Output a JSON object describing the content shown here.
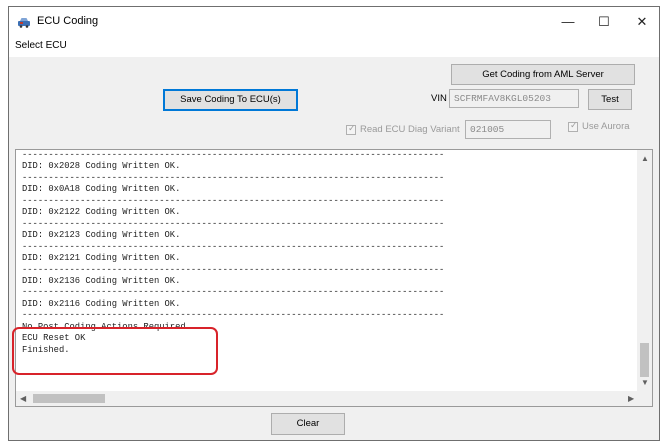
{
  "window": {
    "title": "ECU Coding",
    "controls": {
      "minimize": "—",
      "maximize": "☐",
      "close": "✕"
    }
  },
  "menu": {
    "items": [
      {
        "label": "Select ECU"
      }
    ]
  },
  "toolbar": {
    "get_coding_label": "Get Coding from AML Server",
    "save_coding_label": "Save Coding To ECU(s)",
    "test_label": "Test",
    "clear_label": "Clear"
  },
  "vin": {
    "label": "VIN",
    "value": "SCFRMFAV8KGL05203"
  },
  "diag": {
    "read_variant_label": "Read ECU Diag Variant",
    "read_variant_checked": true,
    "variant_value": "021005",
    "use_aurora_label": "Use Aurora",
    "use_aurora_checked": true
  },
  "log": {
    "separator": "--------------------------------------------------------------------------------",
    "lines": [
      "--------------------------------------------------------------------------------",
      "DID: 0x2028 Coding Written OK.",
      "--------------------------------------------------------------------------------",
      "DID: 0x0A18 Coding Written OK.",
      "--------------------------------------------------------------------------------",
      "DID: 0x2122 Coding Written OK.",
      "--------------------------------------------------------------------------------",
      "DID: 0x2123 Coding Written OK.",
      "--------------------------------------------------------------------------------",
      "DID: 0x2121 Coding Written OK.",
      "--------------------------------------------------------------------------------",
      "DID: 0x2136 Coding Written OK.",
      "--------------------------------------------------------------------------------",
      "DID: 0x2116 Coding Written OK.",
      "--------------------------------------------------------------------------------",
      "No Post Coding Actions Required",
      "ECU Reset OK",
      "Finished."
    ]
  },
  "colors": {
    "highlight": "#d8232a",
    "primary_border": "#0078d7",
    "window_bg": "#f0f0f0"
  },
  "icons": {
    "app": "car-icon",
    "scroll_up": "chevron-up-icon",
    "scroll_down": "chevron-down-icon",
    "scroll_left": "chevron-left-icon",
    "scroll_right": "chevron-right-icon"
  }
}
